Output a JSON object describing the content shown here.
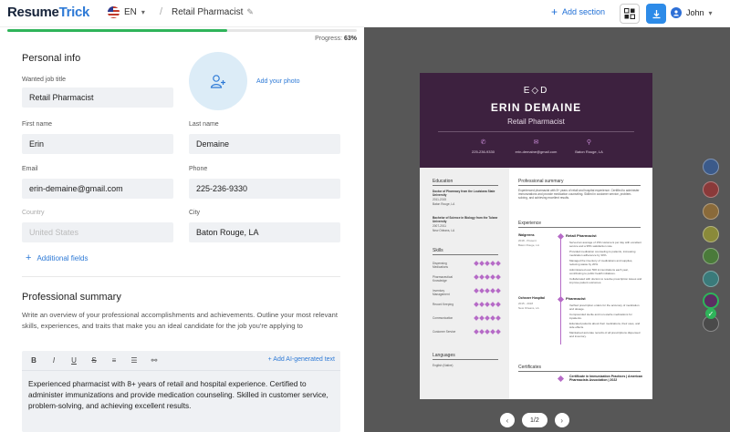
{
  "header": {
    "logo_part1": "Resume",
    "logo_part2": "Trick",
    "language": "EN",
    "separator": "/",
    "document_title": "Retail Pharmacist",
    "add_section": "Add section",
    "user_name": "John",
    "icons": [
      "flag-us-icon",
      "chevron-down-icon",
      "pencil-icon",
      "plus-icon",
      "template-grid-icon",
      "download-icon",
      "user-avatar-icon"
    ]
  },
  "progress": {
    "label": "Progress:",
    "value_text": "63%",
    "value": 0.63
  },
  "personal_info": {
    "title": "Personal info",
    "wanted_job_title_label": "Wanted job title",
    "wanted_job_title_value": "Retail Pharmacist",
    "add_photo": "Add your photo",
    "first_name_label": "First name",
    "first_name_value": "Erin",
    "last_name_label": "Last name",
    "last_name_value": "Demaine",
    "email_label": "Email",
    "email_value": "erin-demaine@gmail.com",
    "phone_label": "Phone",
    "phone_value": "225-236-9330",
    "country_label": "Country",
    "country_placeholder": "United States",
    "city_label": "City",
    "city_value": "Baton Rouge, LA",
    "additional_fields": "Additional fields"
  },
  "summary": {
    "title": "Professional summary",
    "description": "Write an overview of your professional accomplishments and achievements. Outline your most relevant skills, experiences, and traits that make you an ideal candidate for the job you're applying to",
    "toolbar": {
      "bold": "B",
      "italic": "I",
      "underline": "U",
      "strike": "S",
      "bullets": "≡",
      "numbers": "☰",
      "link": "⚯"
    },
    "ai_button": "Add AI-generated text",
    "text": "Experienced pharmacist with 8+ years of retail and hospital experience. Certified to administer immunizations and provide medication counseling. Skilled in customer service, problem-solving, and achieving excellent results."
  },
  "preview": {
    "monogram": "E◇D",
    "name": "ERIN DEMAINE",
    "role": "Retail Pharmacist",
    "phone": "225-236-9330",
    "email": "erin-demaine@gmail.com",
    "location": "Baton Rouge, LA",
    "education_title": "Education",
    "education": [
      {
        "degree": "Doctor of Pharmacy from the Louisiana State University",
        "date": "2011-2015",
        "place": "Baton Rouge, LA"
      },
      {
        "degree": "Bachelor of Science in Biology from the Tulane University",
        "date": "2007-2011",
        "place": "New Orleans, LA"
      }
    ],
    "skills_title": "Skills",
    "skills": [
      {
        "name": "Dispensing Medications",
        "level": 5
      },
      {
        "name": "Pharmaceutical Knowledge",
        "level": 5
      },
      {
        "name": "Inventory Management",
        "level": 5
      },
      {
        "name": "Record Keeping",
        "level": 5
      },
      {
        "name": "Communication",
        "level": 5
      },
      {
        "name": "Customer Service",
        "level": 5
      }
    ],
    "languages_title": "Languages",
    "languages_text": "English (Native)",
    "summary_title": "Professional summary",
    "summary_text": "Experienced pharmacist with 8+ years of retail and hospital experience. Certified to administer immunizations and provide medication counseling. Skilled in customer service, problem-solving, and achieving excellent results.",
    "experience_title": "Experience",
    "jobs": [
      {
        "employer": "Walgreens",
        "dates": "2018 - Present",
        "location": "Baton Rouge, LA",
        "title": "Retail Pharmacist",
        "bullets": [
          "Served an average of 150 customers per day with excellent service and a 95% satisfaction rate.",
          "Provided medication counseling to patients, increasing medication adherence by 30%.",
          "Managed the inventory of medications and supplies, reducing waste by 20%.",
          "Administered over 500 immunizations each year, contributing to public health initiatives.",
          "Collaborated with doctors to resolve prescription issues and improve patient outcomes."
        ]
      },
      {
        "employer": "Ochsner Hospital",
        "dates": "2015 - 2018",
        "location": "New Orleans, LA",
        "title": "Pharmacist",
        "bullets": [
          "Verified prescription orders for the accuracy of medication and dosage.",
          "Compounded sterile and non-sterile medications for inpatients.",
          "Educated patients about their medications, their uses, and side effects.",
          "Maintained accurate records of all prescriptions dispensed and inventory."
        ]
      }
    ],
    "certificates_title": "Certificates",
    "certificate": "Certificate in Immunization Practices | American Pharmacists Association | 2022"
  },
  "colors": [
    "#3b5a8a",
    "#8a3a3a",
    "#8a6a3a",
    "#8a8a3a",
    "#4a7a3a",
    "#3a7a7a",
    "#5c2e62",
    "#4a4a4a"
  ],
  "selected_color_index": 6,
  "pager": {
    "prev": "‹",
    "page": "1/2",
    "next": "›"
  }
}
